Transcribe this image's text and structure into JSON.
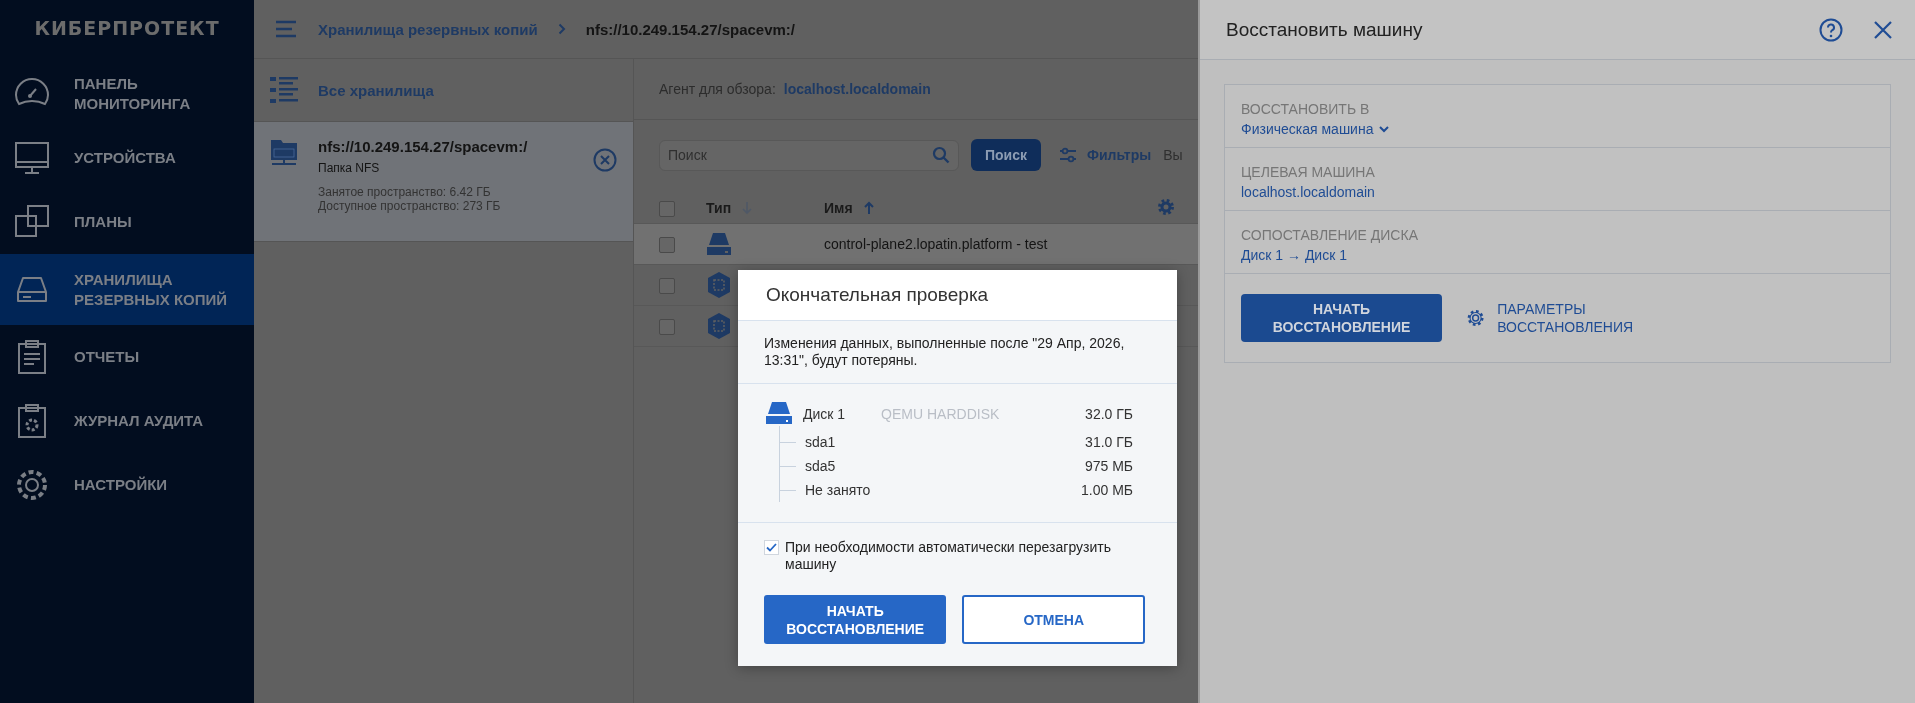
{
  "sidebar": {
    "logo": "КИБЕРПРОТЕКТ",
    "items": [
      {
        "label": "ПАНЕЛЬ МОНИТОРИНГА",
        "selected": false
      },
      {
        "label": "УСТРОЙСТВА",
        "selected": false
      },
      {
        "label": "ПЛАНЫ",
        "selected": false
      },
      {
        "label": "ХРАНИЛИЩА РЕЗЕРВНЫХ КОПИЙ",
        "selected": true
      },
      {
        "label": "ОТЧЕТЫ",
        "selected": false
      },
      {
        "label": "ЖУРНАЛ АУДИТА",
        "selected": false
      },
      {
        "label": "НАСТРОЙКИ",
        "selected": false
      }
    ]
  },
  "breadcrumb": [
    {
      "label": "Хранилища резервных копий"
    },
    {
      "label": "nfs://10.249.154.27/spacevm:/"
    }
  ],
  "storages": {
    "all_label": "Все хранилища",
    "items": [
      {
        "title": "nfs://10.249.154.27/spacevm:/",
        "type": "Папка NFS",
        "used": "Занятое пространство: 6.42 ГБ",
        "free": "Доступное пространство: 273 ГБ",
        "selected": true
      }
    ]
  },
  "browse": {
    "agent_label": "Агент для обзора:",
    "agent": "localhost.localdomain",
    "search": {
      "placeholder": "Поиск"
    },
    "search_button": "Поиск",
    "filters": "Фильтры",
    "cut_label": "Вы",
    "table": {
      "header_checked": false,
      "columns": [
        {
          "label": "Тип",
          "kind": "sort-down",
          "active": false
        },
        {
          "label": "Имя",
          "kind": "sort-up",
          "active": true
        }
      ],
      "rows": [
        {
          "kind": "drive",
          "name": "control-plane2.lopatin.platform - test",
          "checked": false,
          "highlighted": true
        },
        {
          "kind": "cluster",
          "checked": false,
          "highlighted": false
        },
        {
          "kind": "cluster",
          "checked": false,
          "highlighted": false
        }
      ]
    }
  },
  "restore_panel": {
    "title": "Восстановить машину",
    "fields": [
      {
        "kind": "dropdown",
        "label": "ВОССТАНОВИТЬ В",
        "value": "Физическая машина"
      },
      {
        "kind": "link",
        "label": "ЦЕЛЕВАЯ МАШИНА",
        "value": "localhost.localdomain"
      },
      {
        "kind": "link",
        "label": "СОПОСТАВЛЕНИЕ ДИСКА",
        "value": "Диск 1 → Диск 1"
      }
    ],
    "start_button": "НАЧАТЬ ВОССТАНОВЛЕНИЕ",
    "options_link": "ПАРАМЕТРЫ ВОССТАНОВЛЕНИЯ"
  },
  "modal": {
    "title": "Окончательная проверка",
    "warning": "Изменения данных, выполненные после \"29 Апр, 2026, 13:31\", будут потеряны.",
    "disk": {
      "name": "Диск 1",
      "model": "QEMU HARDDISK",
      "size": "32.0 ГБ",
      "partitions": [
        {
          "name": "sda1",
          "size": "31.0 ГБ"
        },
        {
          "name": "sda5",
          "size": "975 МБ"
        },
        {
          "name": "Не занято",
          "size": "1.00 МБ"
        }
      ]
    },
    "reboot": {
      "label": "При необходимости автоматически перезагрузить машину",
      "checked": true
    },
    "buttons": [
      {
        "kind": "primary",
        "label": "НАЧАТЬ ВОССТАНОВЛЕНИЕ"
      },
      {
        "kind": "secondary",
        "label": "ОТМЕНА"
      }
    ]
  }
}
